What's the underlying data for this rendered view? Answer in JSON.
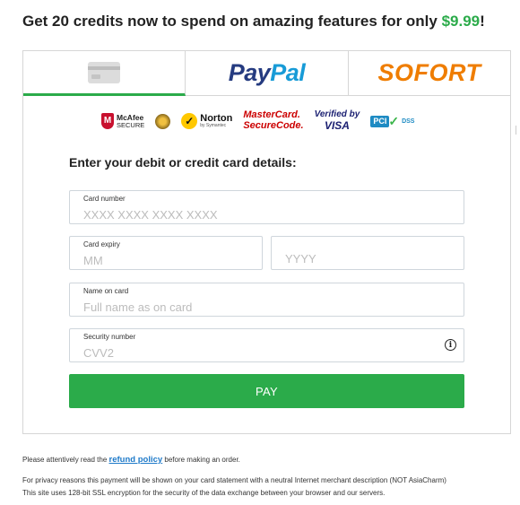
{
  "header": {
    "headline_prefix": "Get 20 credits now to spend on amazing features for only ",
    "price": "$9.99",
    "headline_suffix": "!"
  },
  "tabs": {
    "card_icon": "credit-card-icon",
    "paypal_pay": "Pay",
    "paypal_pal": "Pal",
    "sofort": "SOFORT",
    "selected": "card"
  },
  "badges": {
    "mcafee": "McAfee",
    "mcafee_sub": "SECURE",
    "norton": "Norton",
    "norton_sub": "by Symantec",
    "mastercard_line1": "MasterCard.",
    "mastercard_line2": "SecureCode.",
    "visa_line1": "Verified by",
    "visa_line2": "VISA",
    "pci": "PCI",
    "dss": "DSS"
  },
  "form": {
    "title": "Enter your debit or credit card details:",
    "card_number": {
      "label": "Card number",
      "placeholder": "XXXX XXXX XXXX XXXX"
    },
    "expiry": {
      "label": "Card expiry",
      "placeholder": "MM"
    },
    "year": {
      "placeholder": "YYYY"
    },
    "name": {
      "label": "Name on card",
      "placeholder": "Full name as on card"
    },
    "cvv": {
      "label": "Security number",
      "placeholder": "CVV2"
    },
    "info_icon": "info-icon",
    "pay_label": "PAY"
  },
  "colors": {
    "accent": "#2bab4a",
    "paypal_dark": "#253b80",
    "paypal_light": "#179bd7",
    "sofort": "#ef7d00",
    "link": "#1e7ac9"
  },
  "footer": {
    "refund_prefix": "Please attentively read the ",
    "refund_link": "refund policy",
    "refund_suffix": " before making an order.",
    "privacy_note": "For privacy reasons this payment will be shown on your card statement with a neutral Internet merchant description (NOT AsiaCharm)",
    "ssl_note": "This site uses 128-bit SSL encryption for the security of the data exchange between your browser and our servers."
  }
}
